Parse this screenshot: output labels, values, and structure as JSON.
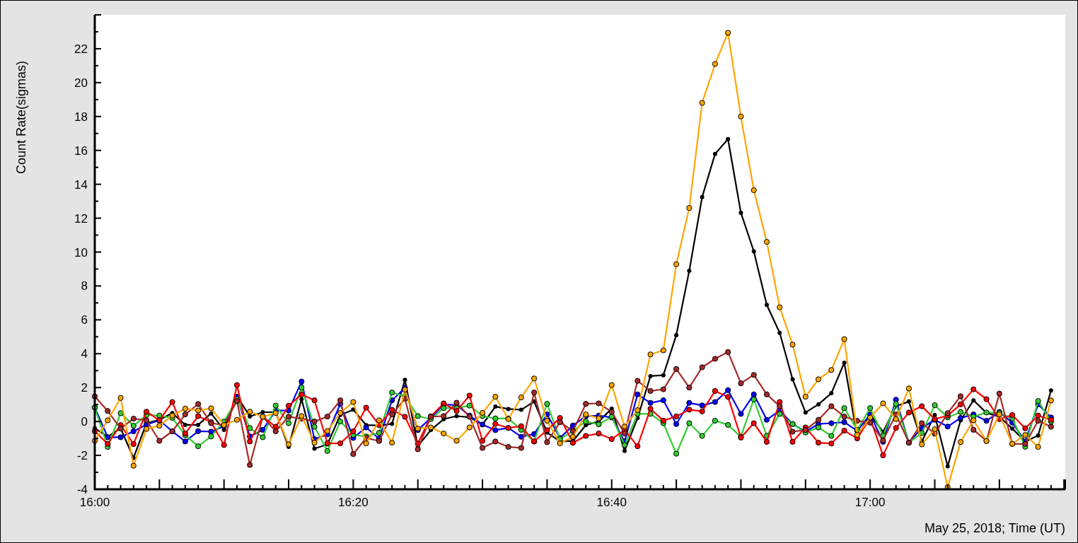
{
  "plot": {
    "chart_data": {
      "type": "line",
      "xlabel": "May 25, 2018; Time (UT)",
      "ylabel": "Count Rate(sigmas)",
      "categories": [
        "16:00",
        null,
        null,
        null,
        null,
        null,
        null,
        null,
        null,
        null,
        null,
        null,
        null,
        null,
        null,
        null,
        null,
        null,
        null,
        null,
        "16:20",
        null,
        null,
        null,
        null,
        null,
        null,
        null,
        null,
        null,
        null,
        null,
        null,
        null,
        null,
        null,
        null,
        null,
        null,
        null,
        "16:40",
        null,
        null,
        null,
        null,
        null,
        null,
        null,
        null,
        null,
        null,
        null,
        null,
        null,
        null,
        null,
        null,
        null,
        null,
        null,
        "17:00",
        null,
        null,
        null,
        null,
        null,
        null,
        null,
        null,
        null,
        null,
        null,
        null,
        null,
        null
      ],
      "series": [
        {
          "color": "#000000",
          "marker": "circle",
          "values": [
            -0.4,
            -0.9,
            -0.4,
            -2.15,
            -0.1,
            0.1,
            0.5,
            -0.2,
            -0.2,
            0.48,
            -0.49,
            1.5,
            0.3,
            0.55,
            0.55,
            -1.5,
            1.32,
            -1.6,
            -1.35,
            0.38,
            0.7,
            -0.21,
            -0.24,
            -0.14,
            2.46,
            -1.46,
            -0.51,
            0.14,
            0.32,
            0.25,
            -0.18,
            0.88,
            0.74,
            0.69,
            1.18,
            -0.65,
            -1.18,
            -1.15,
            -0.21,
            0,
            0.76,
            -1.74,
            0.2,
            2.68,
            2.73,
            5.1,
            8.89,
            13.24,
            15.79,
            16.67,
            12.32,
            10.04,
            6.88,
            5.23,
            2.49,
            0.53,
            1.01,
            1.67,
            3.47,
            -0.9,
            0.42,
            -0.62,
            0.9,
            1.18,
            -1.18,
            0.38,
            -2.64,
            0.07,
            1.25,
            0.51,
            0.28,
            -0.42,
            -1.18,
            -0.83,
            1.83
          ]
        },
        {
          "color": "#0000ff",
          "marker": "circle",
          "values": [
            0.83,
            -0.93,
            -0.93,
            -0.58,
            -0.18,
            0.07,
            -0.58,
            -1.18,
            -0.57,
            -0.6,
            -0.28,
            1.46,
            -0.88,
            -0.49,
            0.65,
            0.65,
            2.36,
            -1.04,
            -0.76,
            1.04,
            -0.97,
            -0.35,
            -1.01,
            1.25,
            1.99,
            -0.51,
            0.21,
            1.0,
            0.97,
            0.35,
            -0.18,
            -0.51,
            -0.38,
            -0.9,
            -0.74,
            0.42,
            -0.97,
            -0.24,
            0.31,
            0.35,
            0.24,
            -1.18,
            1.6,
            1.1,
            1.25,
            -0.15,
            1.1,
            0.95,
            1.15,
            1.85,
            0.45,
            1.6,
            0.1,
            0.65,
            -0.15,
            -0.6,
            -0.15,
            -0.1,
            -0.04,
            -0.55,
            0.42,
            -1.2,
            1.29,
            -1.25,
            -0.38,
            0.1,
            -0.3,
            0.21,
            0.42,
            0.04,
            0.56,
            -0.07,
            -1.18,
            1.01,
            0.24
          ]
        },
        {
          "color": "#33cc33",
          "marker": "circle",
          "values": [
            0.83,
            -1.5,
            0.49,
            -0.25,
            0.38,
            0.35,
            0.21,
            -0.81,
            -1.46,
            -0.88,
            0,
            1.32,
            -0.39,
            -0.93,
            0.94,
            -0.1,
            2.0,
            -0.31,
            -1.74,
            0,
            -0.79,
            -0.88,
            -0.67,
            1.71,
            1.49,
            0.32,
            0.14,
            0.79,
            0.79,
            0.94,
            0.32,
            0.18,
            0.18,
            -0.49,
            -1.18,
            1.04,
            -1.04,
            -0.56,
            0,
            -0.17,
            0.28,
            -1.39,
            0.45,
            0.45,
            -0.1,
            -1.9,
            -0.1,
            -0.85,
            0.05,
            -0.2,
            -0.9,
            1.3,
            -0.85,
            0.45,
            -0.15,
            -0.65,
            -0.35,
            -0.85,
            0.79,
            -0.49,
            0.79,
            -0.83,
            1.04,
            -1.25,
            -0.68,
            0.96,
            0.24,
            0.56,
            0.28,
            0.53,
            0.51,
            0.18,
            -1.49,
            1.21,
            -0.01
          ]
        },
        {
          "color": "#ff0000",
          "marker": "circle",
          "values": [
            -0.58,
            -1.32,
            -0.21,
            -1.33,
            0.58,
            0.07,
            1.15,
            -0.71,
            0.32,
            -0.04,
            -1.39,
            2.15,
            -1.18,
            0.28,
            -0.31,
            0.93,
            1.6,
            1.25,
            -1.28,
            -1.29,
            -0.58,
            0.82,
            -0.21,
            0.69,
            0.28,
            -1.3,
            0.3,
            1.07,
            0.62,
            1.53,
            -1.14,
            -0.14,
            -0.38,
            -0.28,
            -1.18,
            -0.51,
            0.21,
            -1.26,
            -0.85,
            -0.71,
            -1.04,
            -0.5,
            -1.46,
            0.75,
            0.05,
            0.3,
            0.7,
            0.6,
            1.8,
            1.45,
            -0.95,
            -0.1,
            -1.2,
            1.15,
            -1.2,
            -0.35,
            -1.25,
            -1.3,
            -0.54,
            -1.0,
            0.21,
            -2.0,
            -0.38,
            0.53,
            0.9,
            0.14,
            0.35,
            1.01,
            1.9,
            1.32,
            0.14,
            0.38,
            -0.4,
            0.35,
            0.1
          ]
        },
        {
          "color": "#a52a2a",
          "marker": "circle",
          "values": [
            1.48,
            0.62,
            -0.42,
            0.17,
            0.07,
            -1.14,
            -0.58,
            0.42,
            1.03,
            -0.1,
            -0.21,
            1.21,
            -2.57,
            0.28,
            -0.58,
            0.28,
            0.17,
            0,
            0.29,
            1.25,
            -1.92,
            -0.97,
            -1.15,
            0.42,
            1.35,
            -1.64,
            0.28,
            0.32,
            1.11,
            0.28,
            -1.56,
            -1.18,
            -1.5,
            -1.56,
            1.71,
            -1.22,
            -0.04,
            -0.56,
            1.04,
            1.07,
            0.56,
            -0.7,
            2.4,
            1.8,
            1.9,
            3.1,
            2.0,
            3.2,
            3.7,
            4.1,
            2.25,
            2.75,
            1.6,
            0.9,
            -0.6,
            -0.5,
            0.1,
            0.9,
            0.29,
            0.04,
            -0.07,
            -1.11,
            0.42,
            -1.25,
            -0.1,
            -0.72,
            0.49,
            1.49,
            -0.49,
            -1.15,
            1.65,
            -1.32,
            -1.32,
            0.04,
            -0.31
          ]
        },
        {
          "color": "#ffa500",
          "marker": "circle",
          "values": [
            -1.14,
            0.07,
            1.39,
            -2.61,
            -0.44,
            -0.25,
            0.35,
            0.76,
            0.65,
            0.78,
            -0.21,
            0.1,
            0.58,
            0.28,
            0.5,
            -1.35,
            0.32,
            -1.25,
            -0.56,
            0.51,
            1.15,
            -1.29,
            0.07,
            -1.25,
            1.88,
            -0.42,
            -0.35,
            -0.71,
            -1.14,
            -0.35,
            0.51,
            1.46,
            0.14,
            1.42,
            2.54,
            0.04,
            -1.29,
            -0.9,
            0.42,
            0.18,
            2.15,
            -0.3,
            0.67,
            3.96,
            4.2,
            9.28,
            12.6,
            18.8,
            21.1,
            22.94,
            18.0,
            13.65,
            10.6,
            6.74,
            4.54,
            1.46,
            2.49,
            3.04,
            4.86,
            -0.79,
            0.23,
            1.07,
            0.14,
            1.95,
            -1.35,
            -0.46,
            -3.87,
            -1.21,
            0.07,
            -1.15,
            0.42,
            -1.32,
            -0.79,
            -1.5,
            1.24
          ]
        }
      ],
      "ylim": [
        -4,
        24
      ],
      "yticks": [
        -4,
        -2,
        0,
        2,
        4,
        6,
        8,
        10,
        12,
        14,
        16,
        18,
        20,
        22
      ]
    }
  }
}
